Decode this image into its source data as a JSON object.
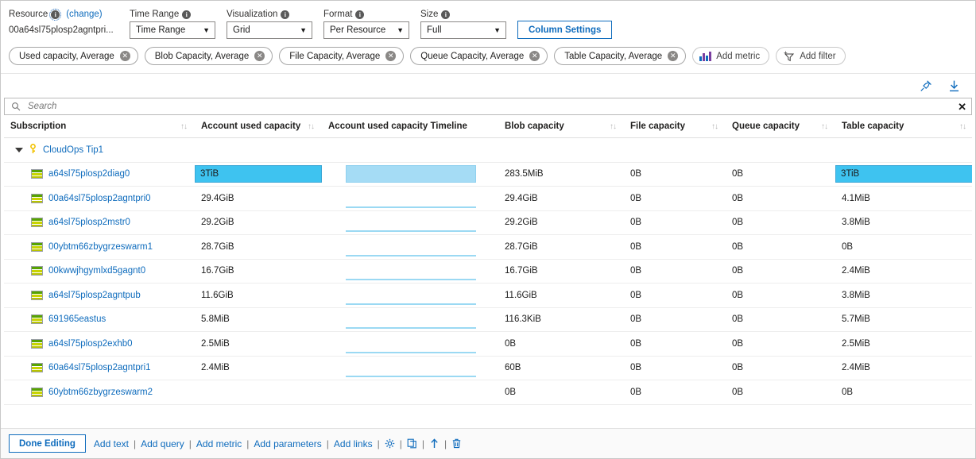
{
  "controls": {
    "resource": {
      "label": "Resource",
      "change_link": "(change)",
      "value": "00a64sl75plosp2agntpri..."
    },
    "time_range": {
      "label": "Time Range",
      "value": "Time Range"
    },
    "visualization": {
      "label": "Visualization",
      "value": "Grid"
    },
    "format": {
      "label": "Format",
      "value": "Per Resource"
    },
    "size": {
      "label": "Size",
      "value": "Full"
    },
    "column_settings_button": "Column Settings"
  },
  "chips": [
    {
      "label": "Used capacity, Average",
      "removable": true
    },
    {
      "label": "Blob Capacity, Average",
      "removable": true
    },
    {
      "label": "File Capacity, Average",
      "removable": true
    },
    {
      "label": "Queue Capacity, Average",
      "removable": true
    },
    {
      "label": "Table Capacity, Average",
      "removable": true
    },
    {
      "label": "Add metric",
      "icon": "bar-chart-icon",
      "removable": false
    },
    {
      "label": "Add filter",
      "icon": "add-filter-funnel-icon",
      "removable": false
    }
  ],
  "actions": {
    "pin_icon": "pin-icon",
    "download_icon": "download-icon"
  },
  "search": {
    "placeholder": "Search",
    "value": "",
    "icon": "search-icon",
    "clear_icon": "close-icon"
  },
  "table": {
    "columns": [
      "Subscription",
      "Account used capacity",
      "Account used capacity Timeline",
      "Blob capacity",
      "File capacity",
      "Queue capacity",
      "Table capacity"
    ],
    "group": {
      "name": "CloudOps Tip1",
      "icon": "key-icon",
      "expanded": true
    },
    "rows": [
      {
        "name": "a64sl75plosp2diag0",
        "used": "3TiB",
        "used_highlight": true,
        "timeline": "area",
        "blob": "283.5MiB",
        "file": "0B",
        "queue": "0B",
        "table": "3TiB",
        "table_highlight": true
      },
      {
        "name": "00a64sl75plosp2agntpri0",
        "used": "29.4GiB",
        "used_highlight": false,
        "timeline": "flat",
        "blob": "29.4GiB",
        "file": "0B",
        "queue": "0B",
        "table": "4.1MiB",
        "table_highlight": false
      },
      {
        "name": "a64sl75plosp2mstr0",
        "used": "29.2GiB",
        "used_highlight": false,
        "timeline": "flat",
        "blob": "29.2GiB",
        "file": "0B",
        "queue": "0B",
        "table": "3.8MiB",
        "table_highlight": false
      },
      {
        "name": "00ybtm66zbygrzeswarm1",
        "used": "28.7GiB",
        "used_highlight": false,
        "timeline": "flat",
        "blob": "28.7GiB",
        "file": "0B",
        "queue": "0B",
        "table": "0B",
        "table_highlight": false
      },
      {
        "name": "00kwwjhgymlxd5gagnt0",
        "used": "16.7GiB",
        "used_highlight": false,
        "timeline": "flat",
        "blob": "16.7GiB",
        "file": "0B",
        "queue": "0B",
        "table": "2.4MiB",
        "table_highlight": false
      },
      {
        "name": "a64sl75plosp2agntpub",
        "used": "11.6GiB",
        "used_highlight": false,
        "timeline": "flat",
        "blob": "11.6GiB",
        "file": "0B",
        "queue": "0B",
        "table": "3.8MiB",
        "table_highlight": false
      },
      {
        "name": "691965eastus",
        "used": "5.8MiB",
        "used_highlight": false,
        "timeline": "flat",
        "blob": "116.3KiB",
        "file": "0B",
        "queue": "0B",
        "table": "5.7MiB",
        "table_highlight": false
      },
      {
        "name": "a64sl75plosp2exhb0",
        "used": "2.5MiB",
        "used_highlight": false,
        "timeline": "flat",
        "blob": "0B",
        "file": "0B",
        "queue": "0B",
        "table": "2.5MiB",
        "table_highlight": false
      },
      {
        "name": "60a64sl75plosp2agntpri1",
        "used": "2.4MiB",
        "used_highlight": false,
        "timeline": "flat",
        "blob": "60B",
        "file": "0B",
        "queue": "0B",
        "table": "2.4MiB",
        "table_highlight": false
      },
      {
        "name": "60ybtm66zbygrzeswarm2",
        "used": "",
        "used_highlight": false,
        "timeline": "none",
        "blob": "0B",
        "file": "0B",
        "queue": "0B",
        "table": "0B",
        "table_highlight": false
      }
    ]
  },
  "footer": {
    "done_editing": "Done Editing",
    "links": [
      "Add text",
      "Add query",
      "Add metric",
      "Add parameters",
      "Add links"
    ],
    "separator": "|",
    "icons": [
      "gear-icon",
      "copy-icon",
      "move-up-icon",
      "delete-icon"
    ]
  },
  "colors": {
    "accent_blue": "#0f6cbd",
    "highlight_cyan": "#3ec3f0",
    "spark_blue": "#a5dcf5"
  }
}
